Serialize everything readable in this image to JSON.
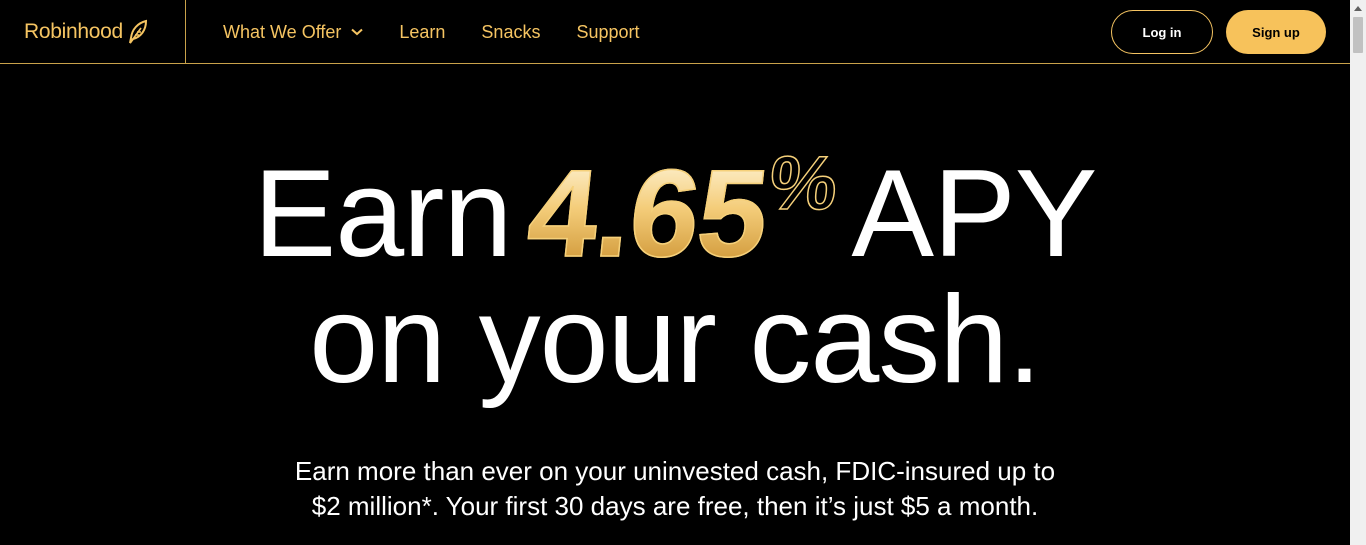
{
  "header": {
    "logo_text": "Robinhood",
    "nav": [
      {
        "label": "What We Offer",
        "has_dropdown": true
      },
      {
        "label": "Learn"
      },
      {
        "label": "Snacks"
      },
      {
        "label": "Support"
      }
    ],
    "login_label": "Log in",
    "signup_label": "Sign up"
  },
  "hero": {
    "line1_prefix": "Earn",
    "rate_number": "4.65",
    "rate_percent": "%",
    "line1_suffix": "APY",
    "line2": "on your cash.",
    "subtitle_line1": "Earn more than ever on your uninvested cash, FDIC-insured up to",
    "subtitle_line2": "$2 million*. Your first 30 days are free, then it’s just $5 a month."
  },
  "colors": {
    "background": "#000000",
    "accent": "#f5c462",
    "signup_bg": "#f7c25b",
    "text": "#ffffff"
  },
  "icons": [
    "feather-logo-icon",
    "chevron-down-icon",
    "scroll-up-arrow-icon"
  ]
}
